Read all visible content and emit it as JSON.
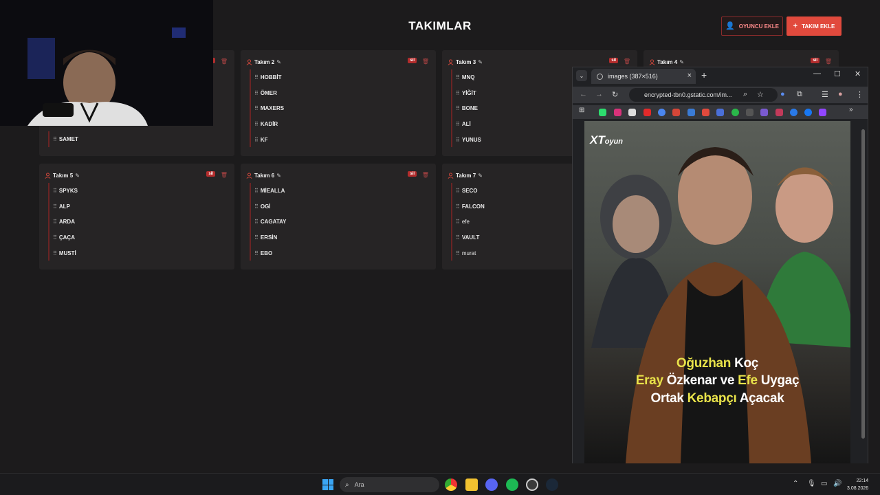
{
  "header": {
    "title": "TAKIMLAR",
    "add_player_label": "OYUNCU EKLE",
    "add_team_label": "TAKIM EKLE"
  },
  "colors": {
    "accent": "#e14a3d",
    "danger": "#b32d2d",
    "card_bg": "#262425",
    "page_bg": "#1c1b1c"
  },
  "delete_label": "sil",
  "teams": [
    {
      "name": "",
      "players": [
        "SAMET"
      ]
    },
    {
      "name": "Takım 2",
      "players": [
        "HOBBİT",
        "ÖMER",
        "MAXERS",
        "KADİR",
        "KF"
      ]
    },
    {
      "name": "Takım 3",
      "players": [
        "MNQ",
        "YİĞİT",
        "BONE",
        "ALİ",
        "YUNUS"
      ]
    },
    {
      "name": "Takım 4",
      "players": []
    },
    {
      "name": "Takım 5",
      "players": [
        "SPYKS",
        "ALP",
        "ARDA",
        "ÇAÇA",
        "MUSTİ"
      ]
    },
    {
      "name": "Takım 6",
      "players": [
        "MİEALLA",
        "OGİ",
        "CAGATAY",
        "ERSİN",
        "EBO"
      ]
    },
    {
      "name": "Takım 7",
      "players": [
        "SECO",
        "FALCON",
        "efe",
        "VAULT",
        "murat"
      ]
    }
  ],
  "browser": {
    "tab_title": "images (387×516)",
    "url": "encrypted-tbn0.gstatic.com/im...",
    "image": {
      "logo": "XT",
      "logo_sub": "oyun",
      "line1": [
        "Oğuzhan",
        " Koç"
      ],
      "line2": [
        "Eray",
        " Özkenar ve ",
        "Efe",
        " Uygaç"
      ],
      "line3": [
        "Ortak ",
        "Kebapçı",
        " Açacak"
      ]
    }
  },
  "taskbar": {
    "search_label": "Ara",
    "time": "22:14",
    "date": "3.08.2026"
  }
}
